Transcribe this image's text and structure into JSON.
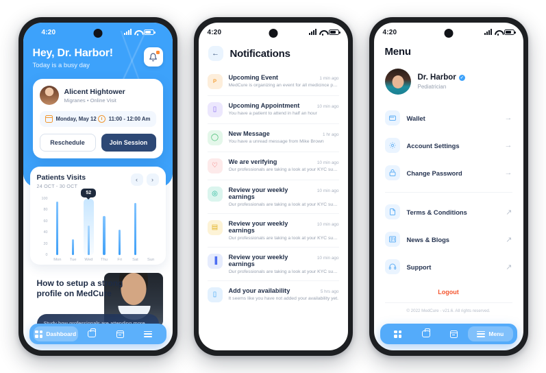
{
  "phones": {
    "dashboard": {
      "status": {
        "time": "4:20",
        "signal_icon": "signal-icon",
        "wifi_icon": "wifi-icon",
        "battery_icon": "battery-icon"
      },
      "header": {
        "greeting": "Hey, Dr. Harbor!",
        "subtitle": "Today is a busy day",
        "bell_icon": "bell-icon"
      },
      "appointment": {
        "patient_name": "Alicent Hightower",
        "patient_meta": "Migranes  •  Online Visit",
        "date": "Monday, May 12",
        "time": "11:00 - 12:00 Am",
        "calendar_icon": "calendar-icon",
        "clock_icon": "clock-icon",
        "reschedule_label": "Reschedule",
        "join_label": "Join Session"
      },
      "chart_card": {
        "title": "Patients Visits",
        "range": "24 OCT - 30 OCT",
        "prev_icon": "chevron-left-icon",
        "next_icon": "chevron-right-icon"
      },
      "promo": {
        "title": "How to setup a strong profile on MedCure",
        "subtitle": "Study how professionals are attending more patients"
      },
      "tabs": [
        {
          "label": "Dashboard",
          "icon": "grid-icon",
          "active": true
        },
        {
          "label": "",
          "icon": "bag-icon",
          "active": false
        },
        {
          "label": "",
          "icon": "calendar-icon",
          "active": false
        },
        {
          "label": "",
          "icon": "menu-icon",
          "active": false
        }
      ]
    },
    "notifications": {
      "status": {
        "time": "4:20"
      },
      "back_icon": "arrow-left-icon",
      "title": "Notifications",
      "items": [
        {
          "icon": "megaphone-icon",
          "glyph": "ᴘ",
          "bg": "#fdeedb",
          "fg": "#f2941f",
          "title": "Upcoming Event",
          "time": "1 min ago",
          "desc": "MedCure is organizing an event for all medicince prac..."
        },
        {
          "icon": "phone-icon",
          "glyph": "▯",
          "bg": "#ece7fd",
          "fg": "#8a6df0",
          "title": "Upcoming Appointment",
          "time": "10 min ago",
          "desc": "You have a patient to attend in half an hour"
        },
        {
          "icon": "chat-icon",
          "glyph": "◯",
          "bg": "#e4f7ea",
          "fg": "#3cb96a",
          "title": "New Message",
          "time": "1 hr ago",
          "desc": "You have a unread message from Mike Brown"
        },
        {
          "icon": "heart-icon",
          "glyph": "♡",
          "bg": "#fdeaea",
          "fg": "#f05a5a",
          "title": "We are verifying",
          "time": "10 min ago",
          "desc": "Our professionals are taking a look at your KYC submi..."
        },
        {
          "icon": "money-icon",
          "glyph": "◎",
          "bg": "#dbf5ee",
          "fg": "#25b89a",
          "title": "Review your weekly earnings",
          "time": "10 min ago",
          "desc": "Our professionals are taking a look at your KYC submi..."
        },
        {
          "icon": "book-icon",
          "glyph": "▤",
          "bg": "#fdf3d6",
          "fg": "#e3b528",
          "title": "Review your weekly earnings",
          "time": "10 min ago",
          "desc": "Our professionals are taking a look at your KYC submi..."
        },
        {
          "icon": "bar-chart-icon",
          "glyph": "▐",
          "bg": "#e6ecfd",
          "fg": "#4d6ef2",
          "title": "Review your weekly earnings",
          "time": "10 min ago",
          "desc": "Our professionals are taking a look at your KYC submi..."
        },
        {
          "icon": "clipboard-icon",
          "glyph": "▯",
          "bg": "#e3f1fe",
          "fg": "#3ea4f5",
          "title": "Add your availability",
          "time": "5 hrs ago",
          "desc": "It seems like you have not added your availability yet."
        }
      ]
    },
    "menu": {
      "status": {
        "time": "4:20"
      },
      "title": "Menu",
      "profile": {
        "name": "Dr. Harbor",
        "role": "Pediatrician",
        "verified_icon": "verified-badge-icon",
        "avatar": "avatar"
      },
      "group_one": [
        {
          "label": "Wallet",
          "icon": "wallet-icon",
          "arrow": "arrow-right-icon"
        },
        {
          "label": "Account Settings",
          "icon": "gear-icon",
          "arrow": "arrow-right-icon"
        },
        {
          "label": "Change Password",
          "icon": "lock-icon",
          "arrow": "arrow-right-icon"
        }
      ],
      "group_two": [
        {
          "label": "Terms & Conditions",
          "icon": "document-icon",
          "arrow": "arrow-up-right-icon"
        },
        {
          "label": "News & Blogs",
          "icon": "news-icon",
          "arrow": "arrow-up-right-icon"
        },
        {
          "label": "Support",
          "icon": "headset-icon",
          "arrow": "arrow-up-right-icon"
        }
      ],
      "logout_label": "Logout",
      "copyright": "© 2022 MedCure - v21.6. All rights reserved.",
      "tabs": [
        {
          "label": "",
          "icon": "grid-icon",
          "active": false
        },
        {
          "label": "",
          "icon": "bag-icon",
          "active": false
        },
        {
          "label": "",
          "icon": "calendar-icon",
          "active": false
        },
        {
          "label": "Menu",
          "icon": "menu-icon",
          "active": true
        }
      ]
    }
  },
  "chart_data": {
    "type": "bar",
    "title": "Patients Visits",
    "subtitle": "24 OCT - 30 OCT",
    "categories": [
      "Mon",
      "Tue",
      "Wed",
      "Thu",
      "Fri",
      "Sat",
      "Sun"
    ],
    "values": [
      95,
      28,
      52,
      70,
      45,
      93,
      0
    ],
    "highlight_index": 2,
    "highlight_label": "52",
    "yticks": [
      100,
      80,
      60,
      40,
      20,
      0
    ],
    "ylim": [
      0,
      100
    ],
    "xlabel": "",
    "ylabel": "",
    "grid": false,
    "legend": "none",
    "bar_color": "#3fa0f7"
  },
  "colors": {
    "brand_blue": "#3da2fb",
    "tabbar_blue": "#5cb0fb",
    "dark_navy": "#2d4875",
    "logout_red": "#f4562f",
    "badge_orange": "#ff8a34"
  }
}
